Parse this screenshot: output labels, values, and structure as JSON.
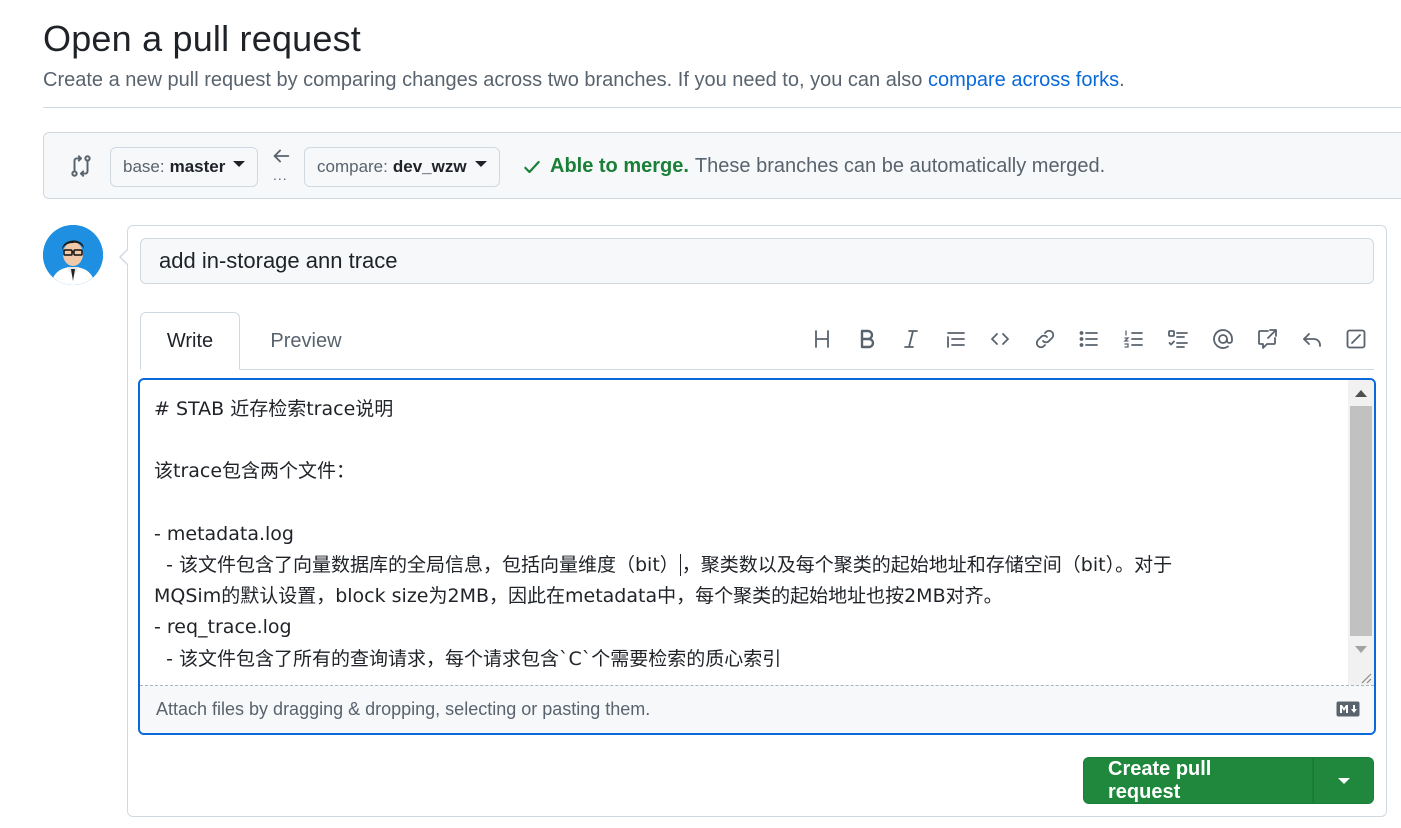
{
  "header": {
    "title": "Open a pull request",
    "subtitle": "Create a new pull request by comparing changes across two branches. If you need to, you can also",
    "forks_link": "compare across forks",
    "subtitle_end": "."
  },
  "compare": {
    "base_prefix": "base:",
    "base_branch": "master",
    "arrow_dots": "...",
    "compare_prefix": "compare:",
    "compare_branch": "dev_wzw",
    "merge_ok": "Able to merge.",
    "merge_msg": "These branches can be automatically merged.",
    "merge_color": "#1a7f37"
  },
  "pr": {
    "title_value": "add in-storage ann trace",
    "tabs": [
      {
        "label": "Write",
        "active": true
      },
      {
        "label": "Preview",
        "active": false
      }
    ],
    "toolbar": [
      "heading-icon",
      "bold-icon",
      "italic-icon",
      "quote-icon",
      "code-icon",
      "link-icon",
      "unordered-list-icon",
      "ordered-list-icon",
      "task-list-icon",
      "mention-icon",
      "reference-icon",
      "reply-icon",
      "fullscreen-icon"
    ],
    "body_lines": [
      "# STAB 近存检索trace说明",
      "",
      "该trace包含两个文件：",
      "",
      "- metadata.log",
      "  - 该文件包含了向量数据库的全局信息，包括向量维度（bit）",
      "，聚类数以及每个聚类的起始地址和存储空间（bit）。对于",
      "MQSim的默认设置，block size为2MB，因此在metadata中，每个聚类的起始地址也按2MB对齐。",
      "- req_trace.log",
      "  - 该文件包含了所有的查询请求，每个请求包含`C`个需要检索的质心索引"
    ],
    "attach_text": "Attach files by dragging & dropping, selecting or pasting them.",
    "submit_label": "Create pull request",
    "accent_color": "#1f883d"
  }
}
